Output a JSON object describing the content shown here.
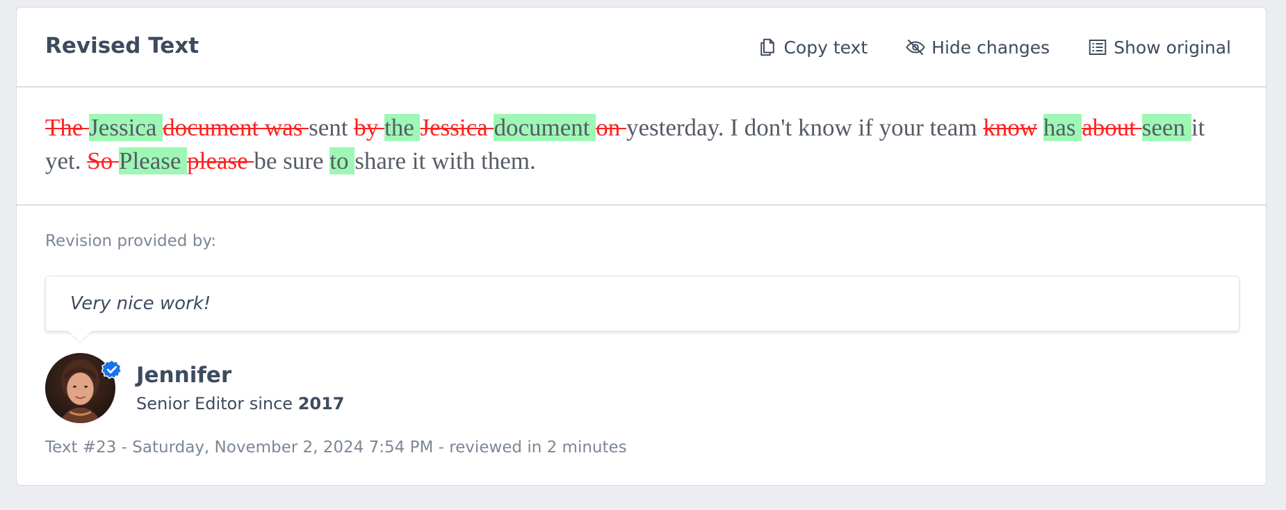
{
  "header": {
    "title": "Revised Text",
    "actions": [
      {
        "label": "Copy text",
        "icon": "copy-icon"
      },
      {
        "label": "Hide changes",
        "icon": "eye-slash-icon"
      },
      {
        "label": "Show original",
        "icon": "list-icon"
      }
    ]
  },
  "revision": {
    "segments": [
      {
        "type": "del",
        "text": "The "
      },
      {
        "type": "ins",
        "text": "Jessica "
      },
      {
        "type": "del",
        "text": "document was "
      },
      {
        "type": "same",
        "text": "sent "
      },
      {
        "type": "del",
        "text": "by "
      },
      {
        "type": "ins",
        "text": "the "
      },
      {
        "type": "del",
        "text": "Jessica "
      },
      {
        "type": "ins",
        "text": "document "
      },
      {
        "type": "del",
        "text": "on "
      },
      {
        "type": "same",
        "text": "yesterday. I don't know if your team "
      },
      {
        "type": "del",
        "text": "know"
      },
      {
        "type": "same",
        "text": " "
      },
      {
        "type": "ins",
        "text": "has "
      },
      {
        "type": "del",
        "text": "about "
      },
      {
        "type": "ins",
        "text": "seen "
      },
      {
        "type": "same",
        "text": "it yet. "
      },
      {
        "type": "del",
        "text": "So "
      },
      {
        "type": "ins",
        "text": "Please "
      },
      {
        "type": "del",
        "text": "please "
      },
      {
        "type": "same",
        "text": "be sure "
      },
      {
        "type": "ins",
        "text": "to "
      },
      {
        "type": "same",
        "text": "share it with them."
      }
    ]
  },
  "footer": {
    "provided_label": "Revision provided by:",
    "comment": "Very nice work!",
    "author": {
      "name": "Jennifer",
      "role_prefix": "Senior Editor since ",
      "role_year": "2017",
      "verified_icon": "verified-badge-icon"
    },
    "meta": "Text #23 - Saturday, November 2, 2024 7:54 PM - reviewed in 2 minutes"
  },
  "colors": {
    "insert_bg": "#9ef7b4",
    "delete_text": "#ff1f1f",
    "text": "#555c66",
    "heading": "#3d4b5e",
    "muted": "#7b8796",
    "verified": "#1a73e8"
  }
}
